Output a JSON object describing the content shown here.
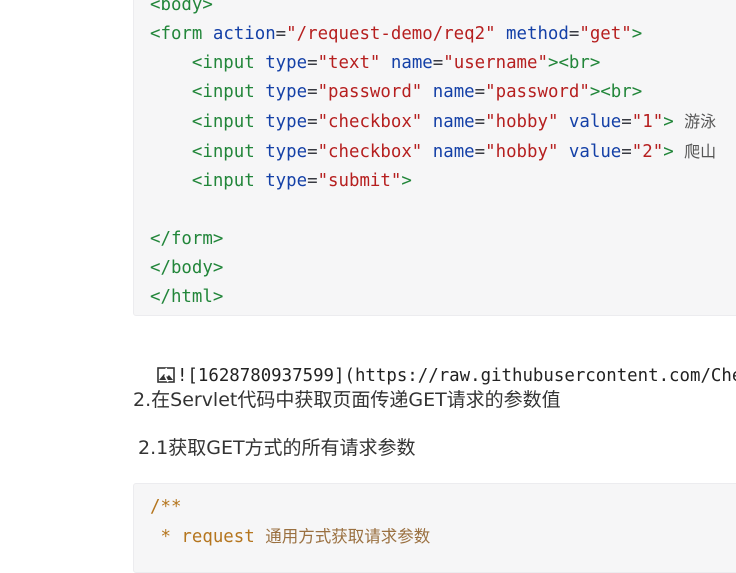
{
  "code_block_1": {
    "lines": [
      [
        {
          "c": "tag",
          "t": "<body>"
        }
      ],
      [
        {
          "c": "tag",
          "t": "<form"
        },
        {
          "c": "",
          "t": " "
        },
        {
          "c": "attr",
          "t": "action"
        },
        {
          "c": "",
          "t": "="
        },
        {
          "c": "str",
          "t": "\"/request-demo/req2\""
        },
        {
          "c": "",
          "t": " "
        },
        {
          "c": "attr",
          "t": "method"
        },
        {
          "c": "",
          "t": "="
        },
        {
          "c": "str",
          "t": "\"get\""
        },
        {
          "c": "tag",
          "t": ">"
        }
      ],
      [
        {
          "c": "",
          "t": "    "
        },
        {
          "c": "tag",
          "t": "<input"
        },
        {
          "c": "",
          "t": " "
        },
        {
          "c": "attr",
          "t": "type"
        },
        {
          "c": "",
          "t": "="
        },
        {
          "c": "str",
          "t": "\"text\""
        },
        {
          "c": "",
          "t": " "
        },
        {
          "c": "attr",
          "t": "name"
        },
        {
          "c": "",
          "t": "="
        },
        {
          "c": "str",
          "t": "\"username\""
        },
        {
          "c": "tag",
          "t": "><br>"
        }
      ],
      [
        {
          "c": "",
          "t": "    "
        },
        {
          "c": "tag",
          "t": "<input"
        },
        {
          "c": "",
          "t": " "
        },
        {
          "c": "attr",
          "t": "type"
        },
        {
          "c": "",
          "t": "="
        },
        {
          "c": "str",
          "t": "\"password\""
        },
        {
          "c": "",
          "t": " "
        },
        {
          "c": "attr",
          "t": "name"
        },
        {
          "c": "",
          "t": "="
        },
        {
          "c": "str",
          "t": "\"password\""
        },
        {
          "c": "tag",
          "t": "><br>"
        }
      ],
      [
        {
          "c": "",
          "t": "    "
        },
        {
          "c": "tag",
          "t": "<input"
        },
        {
          "c": "",
          "t": " "
        },
        {
          "c": "attr",
          "t": "type"
        },
        {
          "c": "",
          "t": "="
        },
        {
          "c": "str",
          "t": "\"checkbox\""
        },
        {
          "c": "",
          "t": " "
        },
        {
          "c": "attr",
          "t": "name"
        },
        {
          "c": "",
          "t": "="
        },
        {
          "c": "str",
          "t": "\"hobby\""
        },
        {
          "c": "",
          "t": " "
        },
        {
          "c": "attr",
          "t": "value"
        },
        {
          "c": "",
          "t": "="
        },
        {
          "c": "str",
          "t": "\"1\""
        },
        {
          "c": "tag",
          "t": ">"
        },
        {
          "c": "",
          "t": " "
        },
        {
          "c": "cjk",
          "t": "游泳"
        }
      ],
      [
        {
          "c": "",
          "t": "    "
        },
        {
          "c": "tag",
          "t": "<input"
        },
        {
          "c": "",
          "t": " "
        },
        {
          "c": "attr",
          "t": "type"
        },
        {
          "c": "",
          "t": "="
        },
        {
          "c": "str",
          "t": "\"checkbox\""
        },
        {
          "c": "",
          "t": " "
        },
        {
          "c": "attr",
          "t": "name"
        },
        {
          "c": "",
          "t": "="
        },
        {
          "c": "str",
          "t": "\"hobby\""
        },
        {
          "c": "",
          "t": " "
        },
        {
          "c": "attr",
          "t": "value"
        },
        {
          "c": "",
          "t": "="
        },
        {
          "c": "str",
          "t": "\"2\""
        },
        {
          "c": "tag",
          "t": ">"
        },
        {
          "c": "",
          "t": " "
        },
        {
          "c": "cjk",
          "t": "爬山"
        }
      ],
      [
        {
          "c": "",
          "t": "    "
        },
        {
          "c": "tag",
          "t": "<input"
        },
        {
          "c": "",
          "t": " "
        },
        {
          "c": "attr",
          "t": "type"
        },
        {
          "c": "",
          "t": "="
        },
        {
          "c": "str",
          "t": "\"submit\""
        },
        {
          "c": "tag",
          "t": ">"
        }
      ],
      [
        {
          "c": "",
          "t": ""
        }
      ],
      [
        {
          "c": "tag",
          "t": "</form>"
        }
      ],
      [
        {
          "c": "tag",
          "t": "</body>"
        }
      ],
      [
        {
          "c": "tag",
          "t": "</html>"
        }
      ]
    ]
  },
  "image_placeholder": {
    "icon": "broken-image-icon",
    "text": "![1628780937599](https://raw.githubusercontent.com/Che"
  },
  "heading_2": "2.在Servlet代码中获取页面传递GET请求的参数值",
  "heading_2_1": "2.1获取GET方式的所有请求参数",
  "code_block_2": {
    "lines": [
      [
        {
          "c": "cmt",
          "t": "/**"
        }
      ],
      [
        {
          "c": "cmt",
          "t": " * "
        },
        {
          "c": "cmt-kw",
          "t": "request"
        },
        {
          "c": "",
          "t": " "
        },
        {
          "c": "cmt-text",
          "t": "通用方式获取请求参数"
        }
      ]
    ]
  },
  "colors": {
    "tag": "#22863a",
    "attribute": "#1440a7",
    "string": "#b61f1f",
    "comment": "#b5761f",
    "code_background": "#f6f6f7"
  }
}
